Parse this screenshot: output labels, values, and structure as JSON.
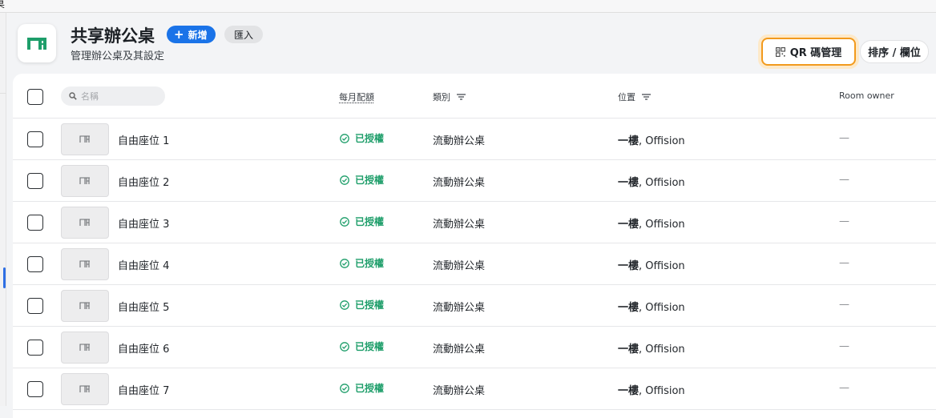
{
  "topbar": {
    "fragment": "桌"
  },
  "header": {
    "title": "共享辦公桌",
    "subtitle": "管理辦公桌及其設定",
    "new_button": "新增",
    "import_button": "匯入",
    "qr_button": "QR 碼管理",
    "sort_button": "排序 / 欄位"
  },
  "table": {
    "search_placeholder": "名稱",
    "columns": {
      "quota": "每月配額",
      "category": "類別",
      "location": "位置",
      "owner": "Room owner"
    },
    "rows": [
      {
        "name": "自由座位 1",
        "status": "已授權",
        "category": "流動辦公桌",
        "floor": "一樓",
        "building": ", Offision",
        "owner": "—"
      },
      {
        "name": "自由座位 2",
        "status": "已授權",
        "category": "流動辦公桌",
        "floor": "一樓",
        "building": ", Offision",
        "owner": "—"
      },
      {
        "name": "自由座位 3",
        "status": "已授權",
        "category": "流動辦公桌",
        "floor": "一樓",
        "building": ", Offision",
        "owner": "—"
      },
      {
        "name": "自由座位 4",
        "status": "已授權",
        "category": "流動辦公桌",
        "floor": "一樓",
        "building": ", Offision",
        "owner": "—"
      },
      {
        "name": "自由座位 5",
        "status": "已授權",
        "category": "流動辦公桌",
        "floor": "一樓",
        "building": ", Offision",
        "owner": "—"
      },
      {
        "name": "自由座位 6",
        "status": "已授權",
        "category": "流動辦公桌",
        "floor": "一樓",
        "building": ", Offision",
        "owner": "—"
      },
      {
        "name": "自由座位 7",
        "status": "已授權",
        "category": "流動辦公桌",
        "floor": "一樓",
        "building": ", Offision",
        "owner": "—"
      }
    ]
  },
  "colors": {
    "brand_green": "#1e9e6a",
    "primary_blue": "#1a73e8",
    "focus_orange": "#f29a1d"
  }
}
